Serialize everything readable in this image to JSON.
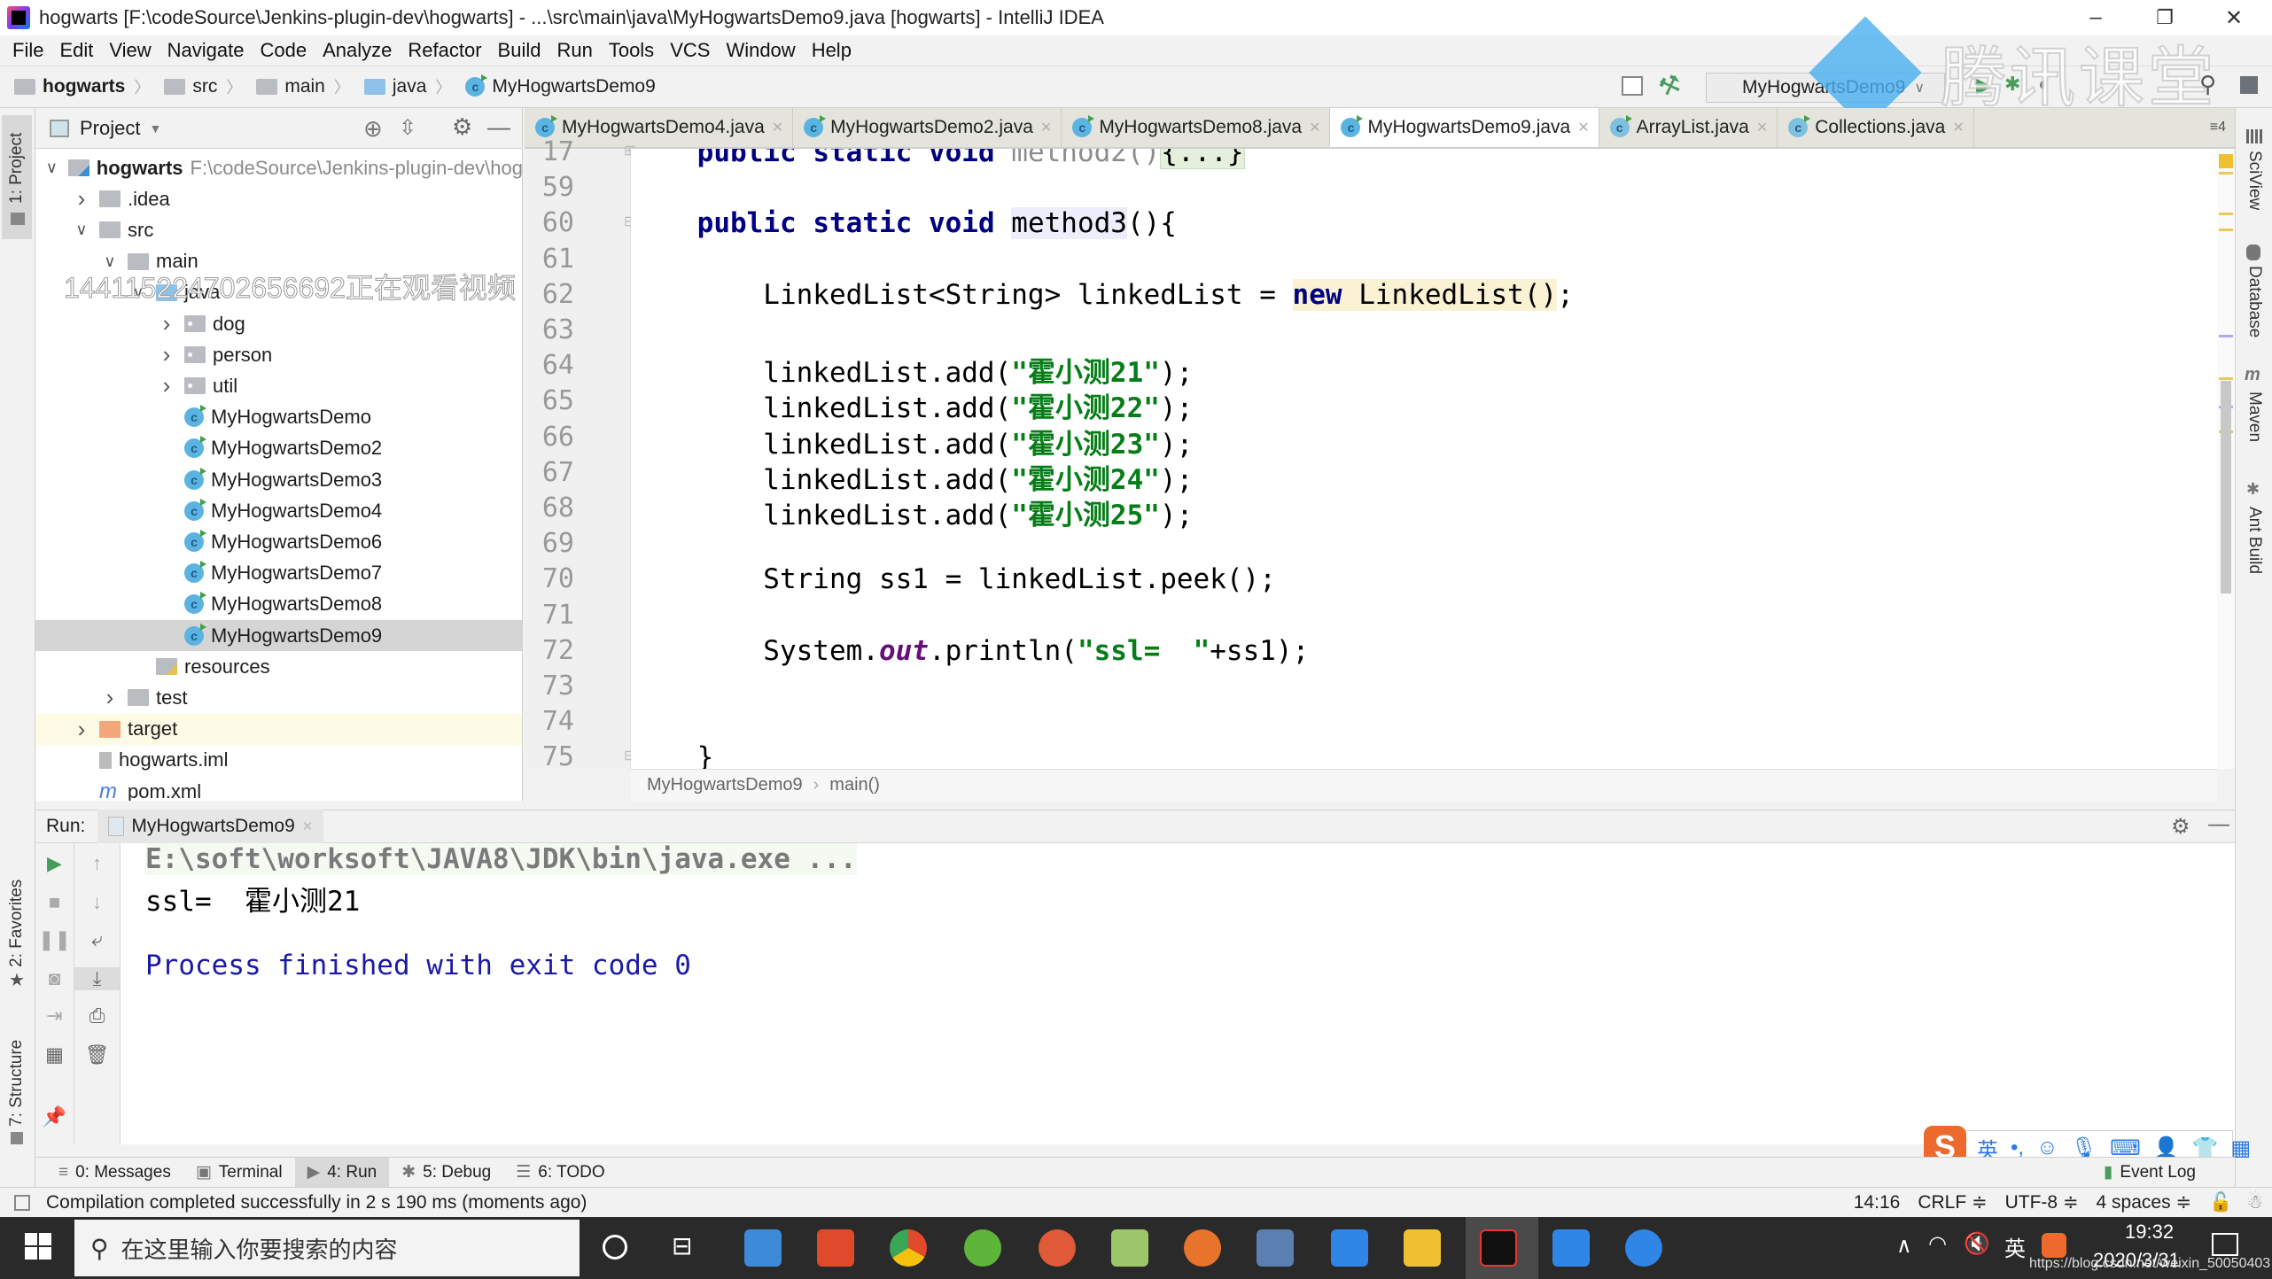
{
  "window": {
    "title": "hogwarts [F:\\codeSource\\Jenkins-plugin-dev\\hogwarts] - ...\\src\\main\\java\\MyHogwartsDemo9.java [hogwarts] - IntelliJ IDEA",
    "controls": {
      "minimize": "–",
      "restore": "❐",
      "close": "✕"
    }
  },
  "menu": [
    "File",
    "Edit",
    "View",
    "Navigate",
    "Code",
    "Analyze",
    "Refactor",
    "Build",
    "Run",
    "Tools",
    "VCS",
    "Window",
    "Help"
  ],
  "navbar": {
    "breadcrumbs": [
      "hogwarts",
      "src",
      "main",
      "java",
      "MyHogwartsDemo9"
    ],
    "run_config": "MyHogwartsDemo9"
  },
  "watermark": {
    "text": "腾讯课堂"
  },
  "overlay_text": "14411522470265669​2正在观看视频",
  "left_stripe": {
    "project": "1: Project",
    "favorites": "2: Favorites",
    "structure": "7: Structure"
  },
  "right_stripe": [
    "SciView",
    "Database",
    "Maven",
    "Ant Build"
  ],
  "project": {
    "header": "Project",
    "tree": [
      {
        "label": "hogwarts",
        "hint": "F:\\codeSource\\Jenkins-plugin-dev\\hog",
        "type": "module",
        "depth": 0,
        "expanded": true
      },
      {
        "label": ".idea",
        "type": "folder",
        "depth": 1,
        "expanded": false
      },
      {
        "label": "src",
        "type": "folder",
        "depth": 1,
        "expanded": true
      },
      {
        "label": "main",
        "type": "folder",
        "depth": 2,
        "expanded": true
      },
      {
        "label": "java",
        "type": "src",
        "depth": 3,
        "expanded": true
      },
      {
        "label": "dog",
        "type": "package",
        "depth": 4,
        "expanded": false
      },
      {
        "label": "person",
        "type": "package",
        "depth": 4,
        "expanded": false
      },
      {
        "label": "util",
        "type": "package",
        "depth": 4,
        "expanded": false
      },
      {
        "label": "MyHogwartsDemo",
        "type": "class",
        "depth": 4
      },
      {
        "label": "MyHogwartsDemo2",
        "type": "class",
        "depth": 4
      },
      {
        "label": "MyHogwartsDemo3",
        "type": "class",
        "depth": 4
      },
      {
        "label": "MyHogwartsDemo4",
        "type": "class",
        "depth": 4
      },
      {
        "label": "MyHogwartsDemo6",
        "type": "class",
        "depth": 4
      },
      {
        "label": "MyHogwartsDemo7",
        "type": "class",
        "depth": 4
      },
      {
        "label": "MyHogwartsDemo8",
        "type": "class",
        "depth": 4
      },
      {
        "label": "MyHogwartsDemo9",
        "type": "class",
        "depth": 4,
        "selected": true
      },
      {
        "label": "resources",
        "type": "resources",
        "depth": 3
      },
      {
        "label": "test",
        "type": "folder",
        "depth": 2,
        "expanded": false
      },
      {
        "label": "target",
        "type": "excluded",
        "depth": 1,
        "expanded": false
      },
      {
        "label": "hogwarts.iml",
        "type": "iml",
        "depth": 1
      },
      {
        "label": "pom.xml",
        "type": "maven",
        "depth": 1
      }
    ]
  },
  "editor": {
    "tabs": [
      {
        "label": "MyHogwartsDemo4.java",
        "active": false
      },
      {
        "label": "MyHogwartsDemo2.java",
        "active": false
      },
      {
        "label": "MyHogwartsDemo8.java",
        "active": false
      },
      {
        "label": "MyHogwartsDemo9.java",
        "active": true
      },
      {
        "label": "ArrayList.java",
        "active": false
      },
      {
        "label": "Collections.java",
        "active": false
      }
    ],
    "tabs_overflow": "≡4",
    "lines": [
      {
        "n": "17",
        "code": "    public static void method2(){...}"
      },
      {
        "n": "59",
        "code": ""
      },
      {
        "n": "60",
        "code": "    public static void method3(){"
      },
      {
        "n": "61",
        "code": ""
      },
      {
        "n": "62",
        "code": "        LinkedList<String> linkedList = new LinkedList();"
      },
      {
        "n": "63",
        "code": ""
      },
      {
        "n": "64",
        "code": "        linkedList.add(\"霍小测21\");"
      },
      {
        "n": "65",
        "code": "        linkedList.add(\"霍小测22\");"
      },
      {
        "n": "66",
        "code": "        linkedList.add(\"霍小测23\");"
      },
      {
        "n": "67",
        "code": "        linkedList.add(\"霍小测24\");"
      },
      {
        "n": "68",
        "code": "        linkedList.add(\"霍小测25\");"
      },
      {
        "n": "69",
        "code": ""
      },
      {
        "n": "70",
        "code": "        String ss1 = linkedList.peek();"
      },
      {
        "n": "71",
        "code": ""
      },
      {
        "n": "72",
        "code": "        System.out.println(\"ssl=  \"+ss1);"
      },
      {
        "n": "73",
        "code": ""
      },
      {
        "n": "74",
        "code": ""
      },
      {
        "n": "75",
        "code": "    }"
      }
    ],
    "breadcrumb": [
      "MyHogwartsDemo9",
      "main()"
    ]
  },
  "run": {
    "label": "Run:",
    "tab": "MyHogwartsDemo9",
    "console": [
      {
        "text": "E:\\soft\\worksoft\\JAVA8\\JDK\\bin\\java.exe ...",
        "kind": "cmd"
      },
      {
        "text": "ssl=  霍小测21",
        "kind": "out"
      },
      {
        "text": "",
        "kind": "out"
      },
      {
        "text": "Process finished with exit code 0",
        "kind": "exit"
      }
    ]
  },
  "tool_windows": [
    {
      "label": "0: Messages",
      "icon": "messages-icon"
    },
    {
      "label": "Terminal",
      "icon": "terminal-icon"
    },
    {
      "label": "4: Run",
      "icon": "run-icon",
      "active": true
    },
    {
      "label": "5: Debug",
      "icon": "debug-icon"
    },
    {
      "label": "6: TODO",
      "icon": "todo-icon"
    }
  ],
  "event_log": "Event Log",
  "status": {
    "message": "Compilation completed successfully in 2 s 190 ms (moments ago)",
    "position": "14:16",
    "line_sep": "CRLF ≑",
    "encoding": "UTF-8 ≑",
    "indent": "4 spaces ≑"
  },
  "ime": {
    "mode": "英"
  },
  "taskbar": {
    "search_placeholder": "在这里输入你要搜索的内容",
    "time": "19:32",
    "date": "2020/3/31",
    "tray_lang": "英",
    "url_overlay": "https://blog.csdn.net/weixin_50050403"
  }
}
